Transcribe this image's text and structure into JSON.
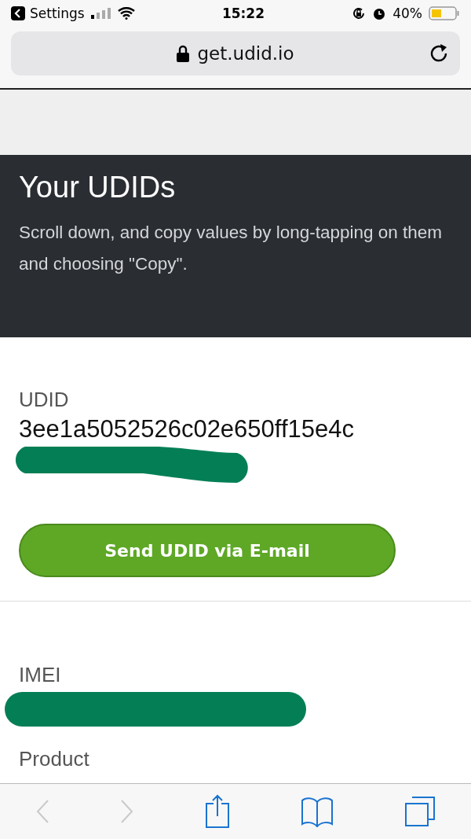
{
  "status_bar": {
    "back_label": "Settings",
    "time": "15:22",
    "battery": "40%"
  },
  "address_bar": {
    "url": "get.udid.io"
  },
  "header": {
    "title": "Your UDIDs",
    "subtitle": "Scroll down, and copy values by long-tapping on them and choosing \"Copy\"."
  },
  "sections": [
    {
      "label": "UDID",
      "value": "3ee1a5052526c02e650ff15e4c",
      "redacted": true,
      "button": "Send UDID via E-mail"
    },
    {
      "label": "IMEI",
      "redacted": true
    },
    {
      "label": "Product"
    }
  ],
  "toolbar": [
    {
      "kind": "back",
      "disabled": true
    },
    {
      "kind": "forward",
      "disabled": true
    },
    {
      "kind": "share",
      "disabled": false
    },
    {
      "kind": "bookmarks",
      "disabled": false
    },
    {
      "kind": "tabs",
      "disabled": false
    }
  ]
}
